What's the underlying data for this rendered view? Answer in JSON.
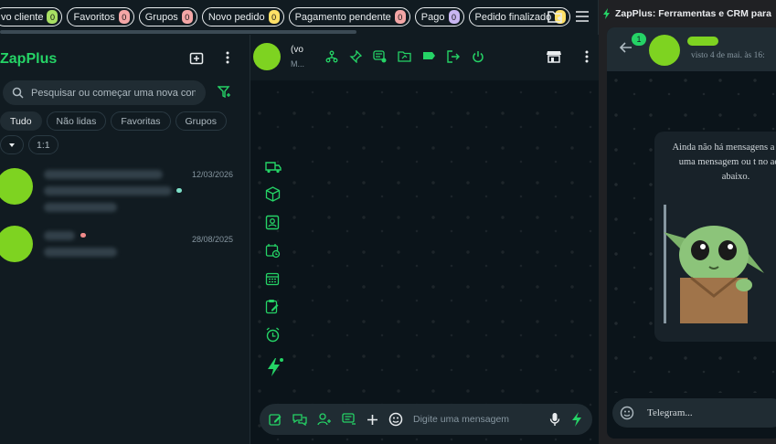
{
  "tags": [
    {
      "label": "vo cliente",
      "count": "0",
      "color": "#a8e063"
    },
    {
      "label": "Favoritos",
      "count": "0",
      "color": "#f4a6a6"
    },
    {
      "label": "Grupos",
      "count": "0",
      "color": "#f4a6a6"
    },
    {
      "label": "Novo pedido",
      "count": "0",
      "color": "#ffe066"
    },
    {
      "label": "Pagamento pendente",
      "count": "0",
      "color": "#f4a6a6"
    },
    {
      "label": "Pago",
      "count": "0",
      "color": "#c9b6f2"
    },
    {
      "label": "Pedido finalizado",
      "count": "",
      "color": "#ffe066"
    }
  ],
  "sidebar": {
    "brand": "ZapPlus",
    "search_placeholder": "Pesquisar ou começar uma nova con...",
    "filters": [
      "Tudo",
      "Não lidas",
      "Favoritas",
      "Grupos"
    ],
    "sort": "1:1",
    "chats": [
      {
        "date": "12/03/2026",
        "tag_color": "#7ee0c8"
      },
      {
        "date": "28/08/2025",
        "tag_color": "#f08a8a"
      }
    ]
  },
  "conversation": {
    "name": "(vo",
    "status": "M...",
    "composer_placeholder": "Digite uma mensagem"
  },
  "extension": {
    "title": "ZapPlus: Ferramentas e CRM para",
    "unread": "1",
    "last_seen": "visto 4 de mai. às 16:",
    "empty_message": "Ainda não há mensagens a Envie uma mensagem ou t no aceno abaixo.",
    "composer_placeholder": "Telegram..."
  },
  "colors": {
    "accent": "#25d366",
    "avatar": "#7ed321"
  }
}
